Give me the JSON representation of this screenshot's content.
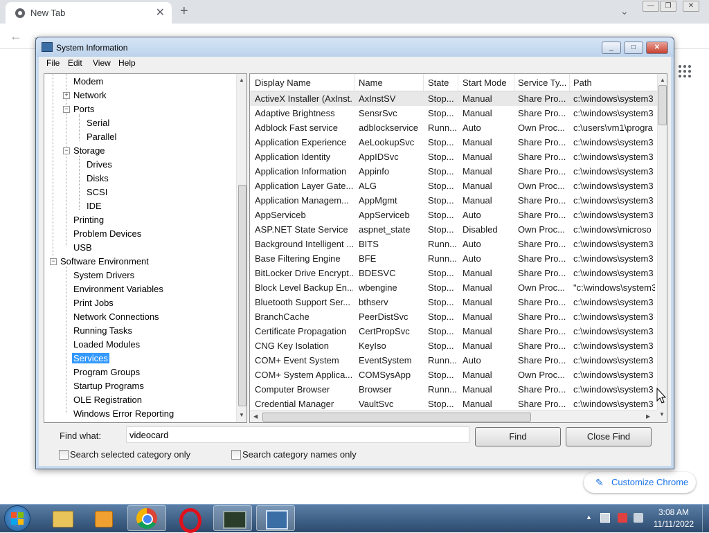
{
  "browser": {
    "tab_title": "New Tab",
    "customize_label": "Customize Chrome"
  },
  "window": {
    "title": "System Information",
    "menu": [
      "File",
      "Edit",
      "View",
      "Help"
    ]
  },
  "tree": {
    "nodes": [
      "Modem",
      "Network",
      "Ports",
      "Serial",
      "Parallel",
      "Storage",
      "Drives",
      "Disks",
      "SCSI",
      "IDE",
      "Printing",
      "Problem Devices",
      "USB",
      "Software Environment",
      "System Drivers",
      "Environment Variables",
      "Print Jobs",
      "Network Connections",
      "Running Tasks",
      "Loaded Modules",
      "Services",
      "Program Groups",
      "Startup Programs",
      "OLE Registration",
      "Windows Error Reporting"
    ],
    "selected": "Services"
  },
  "list": {
    "columns": [
      "Display Name",
      "Name",
      "State",
      "Start Mode",
      "Service Ty...",
      "Path"
    ],
    "rows": [
      [
        "ActiveX Installer (AxInst...",
        "AxInstSV",
        "Stop...",
        "Manual",
        "Share Pro...",
        "c:\\windows\\system3"
      ],
      [
        "Adaptive Brightness",
        "SensrSvc",
        "Stop...",
        "Manual",
        "Share Pro...",
        "c:\\windows\\system3"
      ],
      [
        "Adblock Fast service",
        "adblockservice",
        "Runn...",
        "Auto",
        "Own Proc...",
        "c:\\users\\vm1\\progra"
      ],
      [
        "Application Experience",
        "AeLookupSvc",
        "Stop...",
        "Manual",
        "Share Pro...",
        "c:\\windows\\system3"
      ],
      [
        "Application Identity",
        "AppIDSvc",
        "Stop...",
        "Manual",
        "Share Pro...",
        "c:\\windows\\system3"
      ],
      [
        "Application Information",
        "Appinfo",
        "Stop...",
        "Manual",
        "Share Pro...",
        "c:\\windows\\system3"
      ],
      [
        "Application Layer Gate...",
        "ALG",
        "Stop...",
        "Manual",
        "Own Proc...",
        "c:\\windows\\system3"
      ],
      [
        "Application Managem...",
        "AppMgmt",
        "Stop...",
        "Manual",
        "Share Pro...",
        "c:\\windows\\system3"
      ],
      [
        "AppServiceb",
        "AppServiceb",
        "Stop...",
        "Auto",
        "Share Pro...",
        "c:\\windows\\system3"
      ],
      [
        "ASP.NET State Service",
        "aspnet_state",
        "Stop...",
        "Disabled",
        "Own Proc...",
        "c:\\windows\\microso"
      ],
      [
        "Background Intelligent ...",
        "BITS",
        "Runn...",
        "Auto",
        "Share Pro...",
        "c:\\windows\\system3"
      ],
      [
        "Base Filtering Engine",
        "BFE",
        "Runn...",
        "Auto",
        "Share Pro...",
        "c:\\windows\\system3"
      ],
      [
        "BitLocker Drive Encrypt...",
        "BDESVC",
        "Stop...",
        "Manual",
        "Share Pro...",
        "c:\\windows\\system3"
      ],
      [
        "Block Level Backup En...",
        "wbengine",
        "Stop...",
        "Manual",
        "Own Proc...",
        "\"c:\\windows\\system3"
      ],
      [
        "Bluetooth Support Ser...",
        "bthserv",
        "Stop...",
        "Manual",
        "Share Pro...",
        "c:\\windows\\system3"
      ],
      [
        "BranchCache",
        "PeerDistSvc",
        "Stop...",
        "Manual",
        "Share Pro...",
        "c:\\windows\\system3"
      ],
      [
        "Certificate Propagation",
        "CertPropSvc",
        "Stop...",
        "Manual",
        "Share Pro...",
        "c:\\windows\\system3"
      ],
      [
        "CNG Key Isolation",
        "KeyIso",
        "Stop...",
        "Manual",
        "Share Pro...",
        "c:\\windows\\system3"
      ],
      [
        "COM+ Event System",
        "EventSystem",
        "Runn...",
        "Auto",
        "Share Pro...",
        "c:\\windows\\system3"
      ],
      [
        "COM+ System Applica...",
        "COMSysApp",
        "Stop...",
        "Manual",
        "Own Proc...",
        "c:\\windows\\system3"
      ],
      [
        "Computer Browser",
        "Browser",
        "Runn...",
        "Manual",
        "Share Pro...",
        "c:\\windows\\system3"
      ],
      [
        "Credential Manager",
        "VaultSvc",
        "Stop...",
        "Manual",
        "Share Pro...",
        "c:\\windows\\system3"
      ]
    ]
  },
  "find": {
    "label": "Find what:",
    "value": "videocard",
    "find_button": "Find",
    "close_button": "Close Find",
    "check_selected": "Search selected category only",
    "check_names": "Search category names only"
  },
  "taskbar": {
    "time": "3:08 AM",
    "date": "11/11/2022"
  }
}
